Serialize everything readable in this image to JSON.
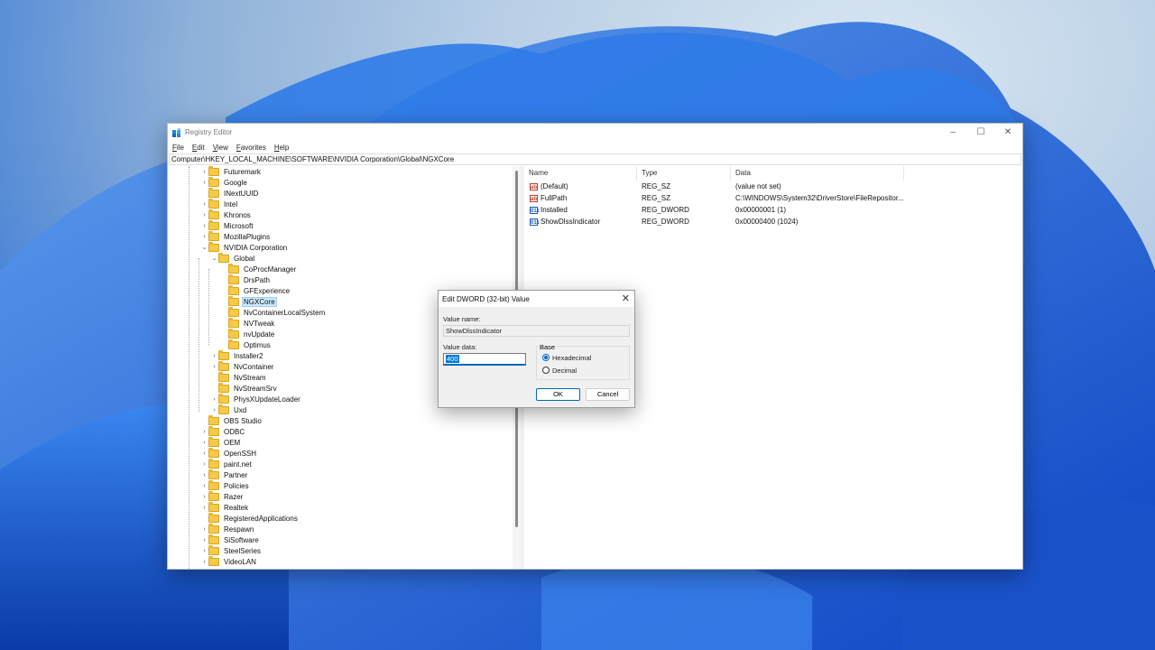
{
  "window": {
    "title": "Registry Editor",
    "controls": {
      "minimize": "–",
      "maximize": "☐",
      "close": "✕"
    }
  },
  "menu": [
    "File",
    "Edit",
    "View",
    "Favorites",
    "Help"
  ],
  "address": "Computer\\HKEY_LOCAL_MACHINE\\SOFTWARE\\NVIDIA Corporation\\Global\\NGXCore",
  "tree": [
    {
      "label": "Futuremark",
      "level": 0,
      "expander": "›"
    },
    {
      "label": "Google",
      "level": 0,
      "expander": "›"
    },
    {
      "label": "INextUUID",
      "level": 0,
      "expander": ""
    },
    {
      "label": "Intel",
      "level": 0,
      "expander": "›"
    },
    {
      "label": "Khronos",
      "level": 0,
      "expander": "›"
    },
    {
      "label": "Microsoft",
      "level": 0,
      "expander": "›"
    },
    {
      "label": "MozillaPlugins",
      "level": 0,
      "expander": "›"
    },
    {
      "label": "NVIDIA Corporation",
      "level": 0,
      "expander": "⌄"
    },
    {
      "label": "Global",
      "level": 1,
      "expander": "⌄"
    },
    {
      "label": "CoProcManager",
      "level": 2,
      "expander": ""
    },
    {
      "label": "DrsPath",
      "level": 2,
      "expander": ""
    },
    {
      "label": "GFExperience",
      "level": 2,
      "expander": ""
    },
    {
      "label": "NGXCore",
      "level": 2,
      "expander": "",
      "selected": true
    },
    {
      "label": "NvContainerLocalSystem",
      "level": 2,
      "expander": ""
    },
    {
      "label": "NVTweak",
      "level": 2,
      "expander": ""
    },
    {
      "label": "nvUpdate",
      "level": 2,
      "expander": ""
    },
    {
      "label": "Optimus",
      "level": 2,
      "expander": ""
    },
    {
      "label": "Installer2",
      "level": 1,
      "expander": "›"
    },
    {
      "label": "NvContainer",
      "level": 1,
      "expander": "›"
    },
    {
      "label": "NvStream",
      "level": 1,
      "expander": ""
    },
    {
      "label": "NvStreamSrv",
      "level": 1,
      "expander": ""
    },
    {
      "label": "PhysXUpdateLoader",
      "level": 1,
      "expander": "›"
    },
    {
      "label": "Uxd",
      "level": 1,
      "expander": "›"
    },
    {
      "label": "OBS Studio",
      "level": 0,
      "expander": ""
    },
    {
      "label": "ODBC",
      "level": 0,
      "expander": "›"
    },
    {
      "label": "OEM",
      "level": 0,
      "expander": "›"
    },
    {
      "label": "OpenSSH",
      "level": 0,
      "expander": "›"
    },
    {
      "label": "paint.net",
      "level": 0,
      "expander": "›"
    },
    {
      "label": "Partner",
      "level": 0,
      "expander": "›"
    },
    {
      "label": "Policies",
      "level": 0,
      "expander": "›"
    },
    {
      "label": "Razer",
      "level": 0,
      "expander": "›"
    },
    {
      "label": "Realtek",
      "level": 0,
      "expander": "›"
    },
    {
      "label": "RegisteredApplications",
      "level": 0,
      "expander": ""
    },
    {
      "label": "Respawn",
      "level": 0,
      "expander": "›"
    },
    {
      "label": "SiSoftware",
      "level": 0,
      "expander": "›"
    },
    {
      "label": "SteelSeries",
      "level": 0,
      "expander": "›"
    },
    {
      "label": "VideoLAN",
      "level": 0,
      "expander": "›"
    }
  ],
  "list": {
    "columns": [
      "Name",
      "Type",
      "Data"
    ],
    "rows": [
      {
        "icon": "ab",
        "name": "(Default)",
        "type": "REG_SZ",
        "data": "(value not set)"
      },
      {
        "icon": "ab",
        "name": "FullPath",
        "type": "REG_SZ",
        "data": "C:\\WINDOWS\\System32\\DriverStore\\FileRepositor..."
      },
      {
        "icon": "011",
        "name": "Installed",
        "type": "REG_DWORD",
        "data": "0x00000001 (1)"
      },
      {
        "icon": "011",
        "name": "ShowDlssIndicator",
        "type": "REG_DWORD",
        "data": "0x00000400 (1024)"
      }
    ]
  },
  "dialog": {
    "title": "Edit DWORD (32-bit) Value",
    "close": "✕",
    "value_name_label": "Value name:",
    "value_name": "ShowDlssIndicator",
    "value_data_label": "Value data:",
    "value_data": "400",
    "base_label": "Base",
    "hex_label": "Hexadecimal",
    "dec_label": "Decimal",
    "ok": "OK",
    "cancel": "Cancel"
  }
}
